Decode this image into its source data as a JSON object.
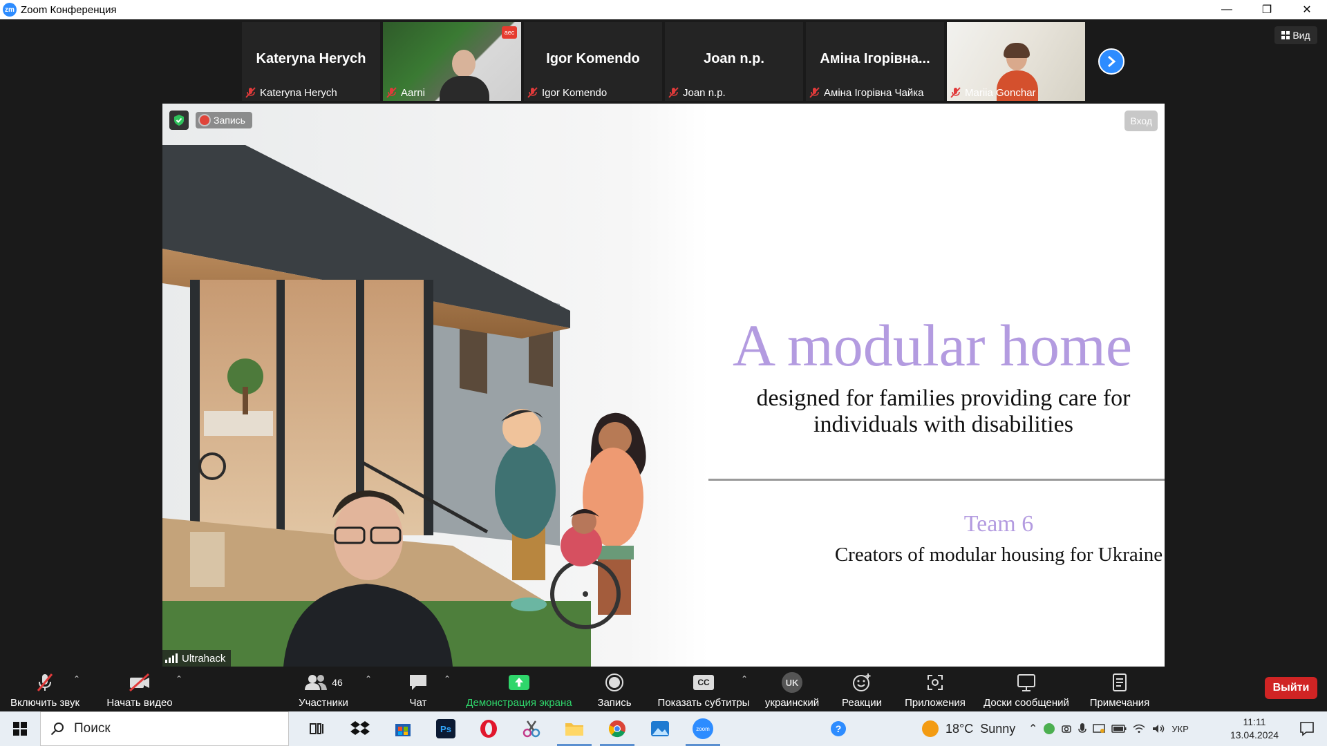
{
  "window": {
    "logo_text": "zm",
    "title": "Zoom Конференция",
    "minimize": "—",
    "restore": "❐",
    "close": "✕"
  },
  "view_button": {
    "label": "Вид"
  },
  "participants": [
    {
      "display_name": "Kateryna Herych",
      "name": "Kateryna Herych",
      "video": false
    },
    {
      "display_name": "",
      "name": "Aarni",
      "video": true,
      "badge": "aec"
    },
    {
      "display_name": "Igor Komendo",
      "name": "Igor Komendo",
      "video": false
    },
    {
      "display_name": "Joan n.p.",
      "name": "Joan n.p.",
      "video": false
    },
    {
      "display_name": "Аміна Ігорівна...",
      "name": "Аміна Ігорівна Чайка",
      "video": false
    },
    {
      "display_name": "",
      "name": "Mariia Gonchar",
      "video": true
    }
  ],
  "share": {
    "recording_label": "Запись",
    "enter_button": "Вход",
    "presenter_tag": "Ultrahack",
    "slide": {
      "title": "A modular home",
      "subtitle": "designed for families providing care for individuals with disabilities",
      "team_title": "Team 6",
      "team_subtitle": "Creators of modular housing for Ukraine"
    }
  },
  "toolbar": {
    "unmute": "Включить звук",
    "start_video": "Начать видео",
    "participants": "Участники",
    "participants_count": "46",
    "chat": "Чат",
    "share_screen": "Демонстрация экрана",
    "record": "Запись",
    "captions": "Показать субтитры",
    "captions_icon_text": "CC",
    "language": "украинский",
    "language_badge": "UK",
    "reactions": "Реакции",
    "apps": "Приложения",
    "whiteboards": "Доски сообщений",
    "notes": "Примечания",
    "leave": "Выйти"
  },
  "taskbar": {
    "search_label": "Поиск",
    "weather_temp": "18°C",
    "weather_text": "Sunny",
    "language": "УКР",
    "time": "11:11",
    "date": "13.04.2024"
  },
  "colors": {
    "zoom_blue": "#2d8cff",
    "leave_red": "#d02424",
    "share_green": "#2fd66b",
    "slide_purple": "#b39be0"
  }
}
